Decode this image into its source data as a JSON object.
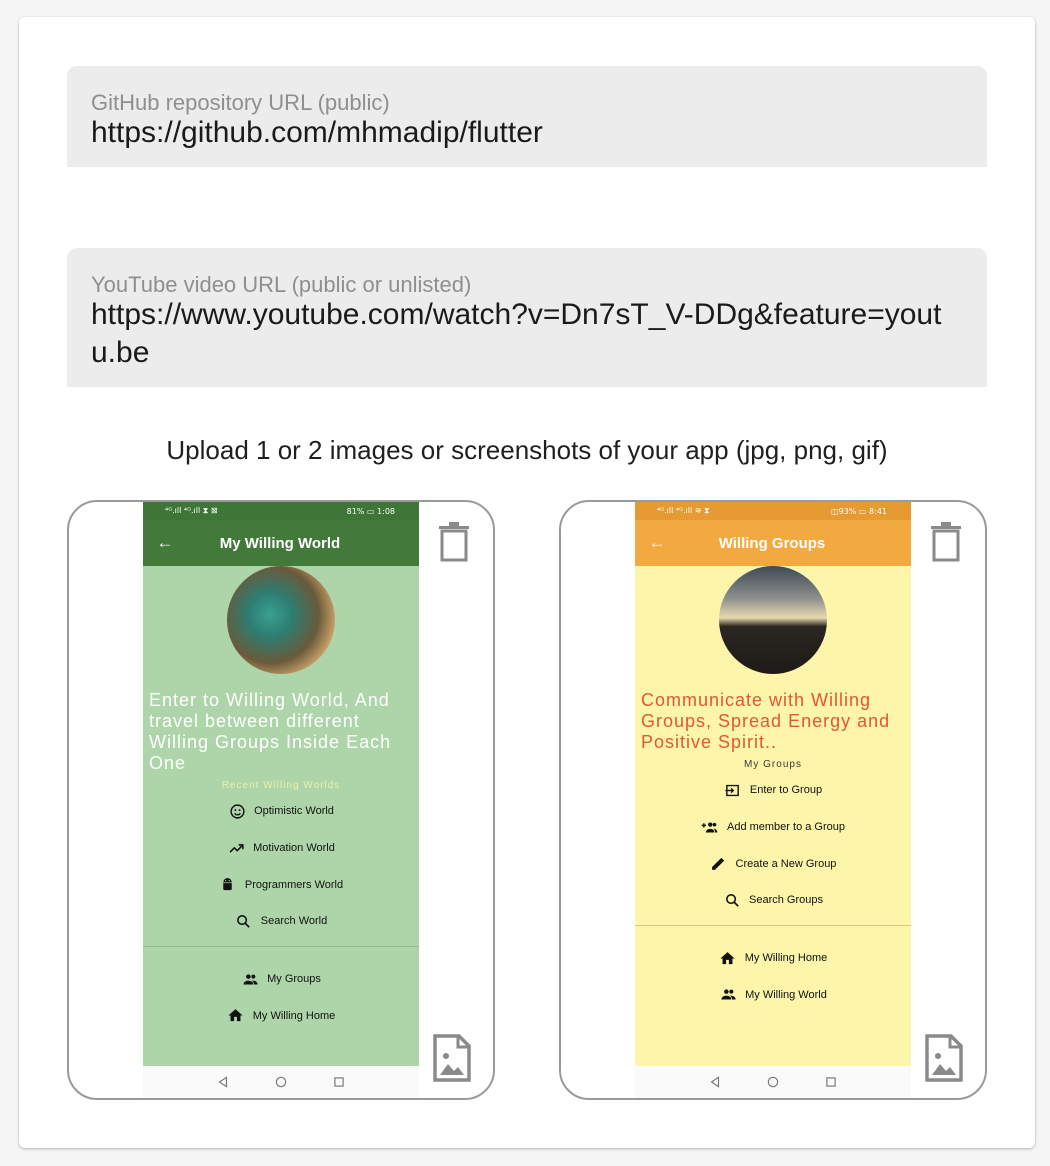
{
  "github": {
    "label": "GitHub repository URL (public)",
    "value": "https://github.com/mhmadip/flutter"
  },
  "youtube": {
    "label": "YouTube video URL (public or unlisted)",
    "value": "https://www.youtube.com/watch?v=Dn7sT_V-DDg&feature=youtu.be"
  },
  "upload": {
    "label": "Upload 1 or 2 images or screenshots of your app (jpg, png, gif)"
  },
  "shot1": {
    "status_left": "⁴ᴳ.ıll ⁴ᴳ.ıll ⧗ ⊠",
    "status_right": "81% ▭ 1:08",
    "title": "My Willing World",
    "headline": "Enter to Willing World, And travel between different Willing Groups Inside Each One",
    "subheading": "Recent Willing Worlds",
    "items": [
      "Optimistic World",
      "Motivation World",
      "Programmers World",
      "Search World"
    ],
    "bottom_items": [
      "My Groups",
      "My Willing Home"
    ],
    "colors": {
      "appbar": "#427a3a",
      "statusbar": "#3d7637",
      "body": "#aed5a9",
      "divider": "#93b98e",
      "headline": "#ffffff",
      "subheading": "#e9f2a9"
    }
  },
  "shot2": {
    "status_left": "⁴ᴳ.ıll ⁴ᴳ.ıll ≋ ⧗",
    "status_right": "◫93% ▭ 8:41",
    "title": "Willing Groups",
    "headline": "Communicate with Willing Groups, Spread Energy and Positive Spirit..",
    "subheading": "My Groups",
    "items": [
      "Enter to Group",
      "Add member to a Group",
      "Create a New Group",
      "Search Groups"
    ],
    "bottom_items": [
      "My Willing Home",
      "My Willing World"
    ],
    "colors": {
      "appbar": "#f2a93f",
      "statusbar": "#e69b32",
      "body": "#fdf5a9",
      "divider": "#e6c27a",
      "headline": "#e0573a",
      "subheading": "#3a3a3a"
    }
  },
  "icons": {
    "shot1_items": [
      "smile-icon",
      "trending-up-icon",
      "android-icon",
      "search-icon"
    ],
    "shot1_bottom": [
      "people-icon",
      "home-icon"
    ],
    "shot2_items": [
      "login-icon",
      "add-member-icon",
      "edit-pencil-icon",
      "search-icon"
    ],
    "shot2_bottom": [
      "home-icon",
      "people-icon"
    ],
    "tile_actions": [
      "trash-icon",
      "image-file-icon"
    ]
  }
}
